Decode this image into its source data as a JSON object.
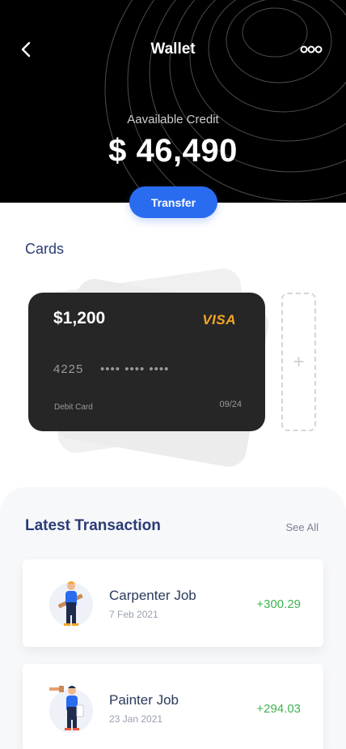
{
  "header": {
    "title": "Wallet",
    "back_icon": "chevron-left-icon",
    "more_icon": "more-dots-icon",
    "credit_label": "Aavailable Credit",
    "credit_amount": "$ 46,490",
    "transfer_label": "Transfer"
  },
  "cards": {
    "title": "Cards",
    "items": [
      {
        "balance": "$1,200",
        "brand": "VISA",
        "number_prefix": "4225",
        "number_masked": "•••• •••• ••••",
        "type": "Debit Card",
        "expiry": "09/24"
      }
    ],
    "add_label": "+"
  },
  "transactions": {
    "title": "Latest Transaction",
    "see_all": "See All",
    "items": [
      {
        "name": "Carpenter Job",
        "date": "7 Feb 2021",
        "amount": "+300.29",
        "icon": "carpenter-avatar-icon"
      },
      {
        "name": "Painter Job",
        "date": "23 Jan 2021",
        "amount": "+294.03",
        "icon": "painter-avatar-icon"
      }
    ]
  },
  "colors": {
    "accent": "#2a6cf0",
    "heading": "#2b3b74",
    "positive": "#3fb34f",
    "visa": "#f5a623"
  }
}
